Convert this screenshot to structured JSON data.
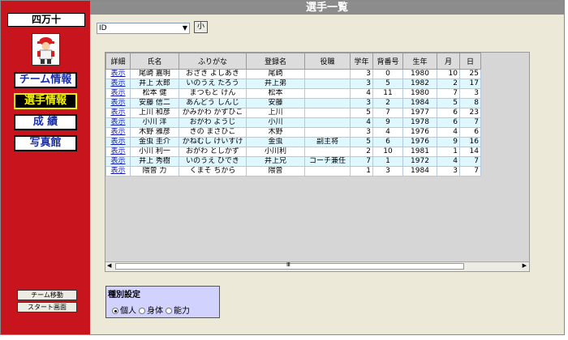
{
  "sidebar": {
    "team_name": "四万十",
    "nav": [
      {
        "label": "チーム情報"
      },
      {
        "label": "選手情報"
      },
      {
        "label": "成 績"
      },
      {
        "label": "写真館"
      }
    ],
    "team_move_label": "チーム移動",
    "start_screen_label": "スタート画面"
  },
  "header": {
    "title": "選手一覧"
  },
  "sort": {
    "selected": "ID",
    "small_label": "小"
  },
  "table": {
    "columns": [
      "詳細",
      "氏名",
      "ふりがな",
      "登録名",
      "役職",
      "学年",
      "背番号",
      "生年",
      "月",
      "日"
    ],
    "rows": [
      [
        "表示",
        "尾崎 嘉明",
        "おざき よしあき",
        "尾崎",
        "",
        "3",
        "0",
        "1980",
        "10",
        "25"
      ],
      [
        "表示",
        "井上 太郎",
        "いのうえ たろう",
        "井上弟",
        "",
        "3",
        "5",
        "1982",
        "2",
        "17"
      ],
      [
        "表示",
        "松本 健",
        "まつもと けん",
        "松本",
        "",
        "4",
        "11",
        "1980",
        "7",
        "3"
      ],
      [
        "表示",
        "安藤 信二",
        "あんどう しんじ",
        "安藤",
        "",
        "3",
        "2",
        "1984",
        "5",
        "8"
      ],
      [
        "表示",
        "上川 和彦",
        "かみかわ かずひこ",
        "上川",
        "",
        "5",
        "7",
        "1977",
        "6",
        "23"
      ],
      [
        "表示",
        "小川 洋",
        "おがわ ようじ",
        "小川",
        "",
        "4",
        "9",
        "1978",
        "6",
        "7"
      ],
      [
        "表示",
        "木野 雅彦",
        "きの まさひこ",
        "木野",
        "",
        "3",
        "4",
        "1976",
        "4",
        "6"
      ],
      [
        "表示",
        "金虫 圭介",
        "かねむし けいすけ",
        "金虫",
        "副主将",
        "5",
        "6",
        "1976",
        "9",
        "16"
      ],
      [
        "表示",
        "小川 利一",
        "おがわ としかず",
        "小川利",
        "",
        "2",
        "10",
        "1981",
        "1",
        "14"
      ],
      [
        "表示",
        "井上 秀樹",
        "いのうえ ひでき",
        "井上兄",
        "コーチ兼任",
        "7",
        "1",
        "1972",
        "4",
        "7"
      ],
      [
        "表示",
        "隈曽 力",
        "くまそ ちから",
        "隈曽",
        "",
        "1",
        "3",
        "1984",
        "3",
        "7"
      ]
    ]
  },
  "type_setting": {
    "label": "種別設定",
    "options": [
      "個人",
      "身体",
      "能力"
    ],
    "selected_index": 0
  }
}
